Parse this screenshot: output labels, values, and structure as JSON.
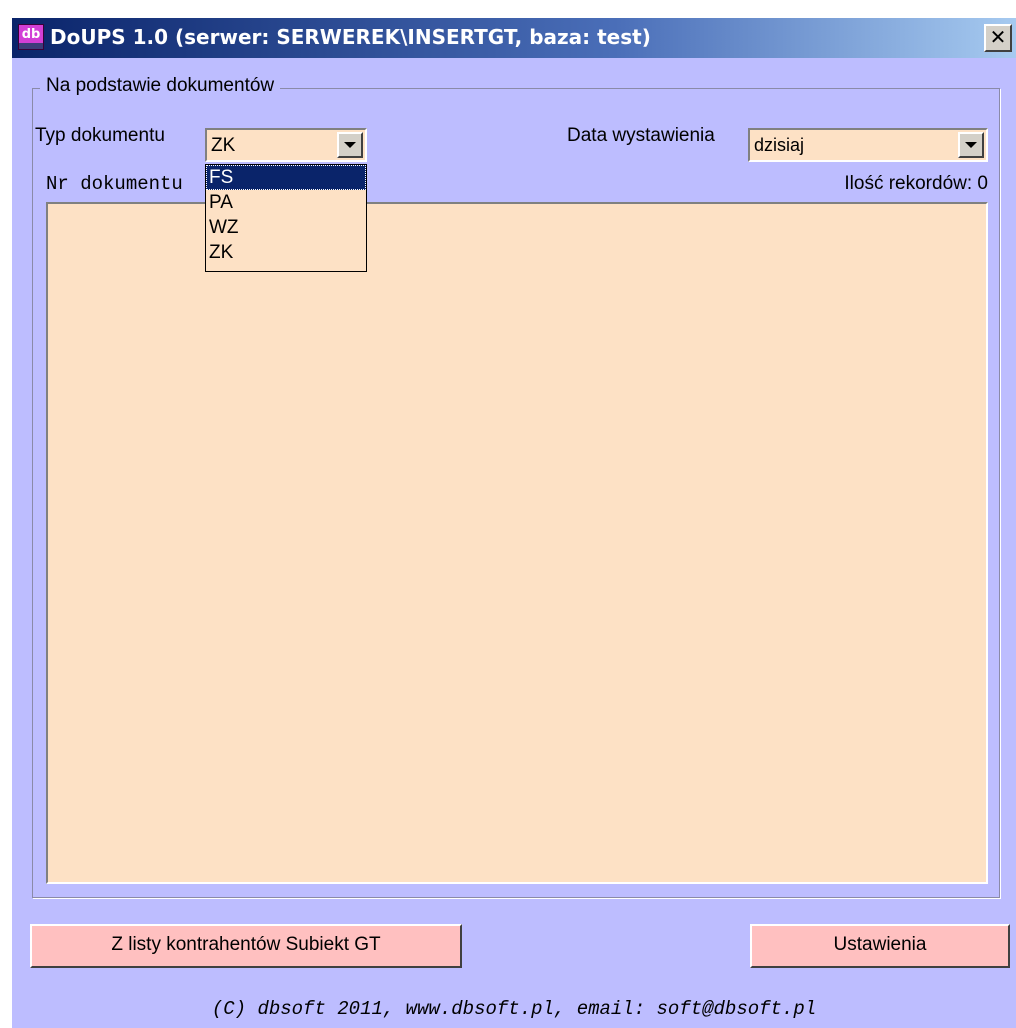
{
  "window": {
    "title": "DoUPS 1.0 (serwer: SERWEREK\\INSERTGT, baza: test)",
    "icon_text": "db",
    "close_symbol": "✕"
  },
  "group": {
    "legend": "Na podstawie dokumentów"
  },
  "doc_type": {
    "label": "Typ dokumentu",
    "selected": "ZK",
    "options": [
      "FS",
      "PA",
      "WZ",
      "ZK"
    ],
    "highlighted": "FS"
  },
  "date": {
    "label": "Data wystawienia",
    "selected": "dzisiaj"
  },
  "list": {
    "header": "Nr dokumentu",
    "record_count": "Ilość rekordów: 0"
  },
  "buttons": {
    "from_contractors": "Z listy kontrahentów Subiekt GT",
    "settings": "Ustawienia"
  },
  "footer": "(C) dbsoft 2011, www.dbsoft.pl, email: soft@dbsoft.pl",
  "colors": {
    "window_bg": "#bdbdff",
    "field_bg": "#fde1c5",
    "button_bg": "#ffc0c0",
    "selection": "#0a246a"
  }
}
